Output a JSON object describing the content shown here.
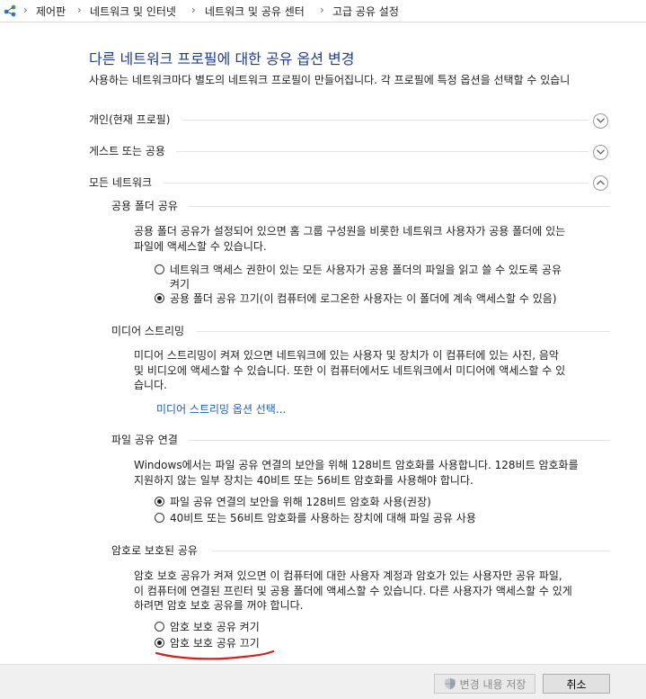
{
  "breadcrumb": {
    "items": [
      "제어판",
      "네트워크 및 인터넷",
      "네트워크 및 공유 센터",
      "고급 공유 설정"
    ],
    "separator": "›"
  },
  "title": "다른 네트워크 프로필에 대한 공유 옵션 변경",
  "subtitle": "사용하는 네트워크마다 별도의 네트워크 프로필이 만들어집니다. 각 프로필에 특정 옵션을 선택할 수 있습니",
  "profiles": {
    "private": {
      "label": "개인(현재 프로필)",
      "state": "collapsed"
    },
    "guest": {
      "label": "게스트 또는 공용",
      "state": "collapsed"
    },
    "all": {
      "label": "모든 네트워크",
      "state": "expanded"
    }
  },
  "public_folder": {
    "heading": "공용 폴더 공유",
    "desc1": "공용 폴더 공유가 설정되어 있으면 홈 그룹 구성원을 비롯한 네트워크 사용자가 공용 폴더에 있는",
    "desc2": "파일에 액세스할 수 있습니다.",
    "option_on_line1": "네트워크 액세스 권한이 있는 모든 사용자가 공용 폴더의 파일을 읽고 쓸 수 있도록 공유",
    "option_on_line2": "켜기",
    "option_off": "공용 폴더 공유 끄기(이 컴퓨터에 로그온한 사용자는 이 폴더에 계속 액세스할 수 있음)",
    "selected": "off"
  },
  "media": {
    "heading": "미디어 스트리밍",
    "desc1": "미디어 스트리밍이 켜져 있으면 네트워크에 있는 사용자 및 장치가 이 컴퓨터에 있는 사진, 음악",
    "desc2": "및 비디오에 액세스할 수 있습니다. 또한 이 컴퓨터에서도 네트워크에서 미디어에 액세스할 수 있",
    "desc3": "습니다.",
    "link": "미디어 스트리밍 옵션 선택..."
  },
  "file_sharing": {
    "heading": "파일 공유 연결",
    "desc1": "Windows에서는 파일 공유 연결의 보안을 위해 128비트 암호화를 사용합니다. 128비트 암호화를",
    "desc2": "지원하지 않는 일부 장치는 40비트 또는 56비트 암호화를 사용해야 합니다.",
    "option_128": "파일 공유 연결의 보안을 위해 128비트 암호화 사용(권장)",
    "option_40_56": "40비트 또는 56비트 암호화를 사용하는 장치에 대해 파일 공유 사용",
    "selected": "128"
  },
  "password": {
    "heading": "암호로 보호된 공유",
    "desc1": "암호 보호 공유가 켜져 있으면 이 컴퓨터에 대한 사용자 계정과 암호가 있는 사용자만 공유 파일,",
    "desc2": "이 컴퓨터에 연결된 프린터 및 공용 폴더에 액세스할 수 있습니다. 다른 사용자가 액세스할 수 있게",
    "desc3": "하려면 암호 보호 공유를 꺼야 합니다.",
    "option_on": "암호 보호 공유 켜기",
    "option_off": "암호 보호 공유 끄기",
    "selected": "off"
  },
  "footer": {
    "save_label": "변경 내용 저장",
    "cancel_label": "취소"
  },
  "colors": {
    "title": "#1e3d8f",
    "link": "#1a5fb4",
    "annotation": "#d62020"
  }
}
